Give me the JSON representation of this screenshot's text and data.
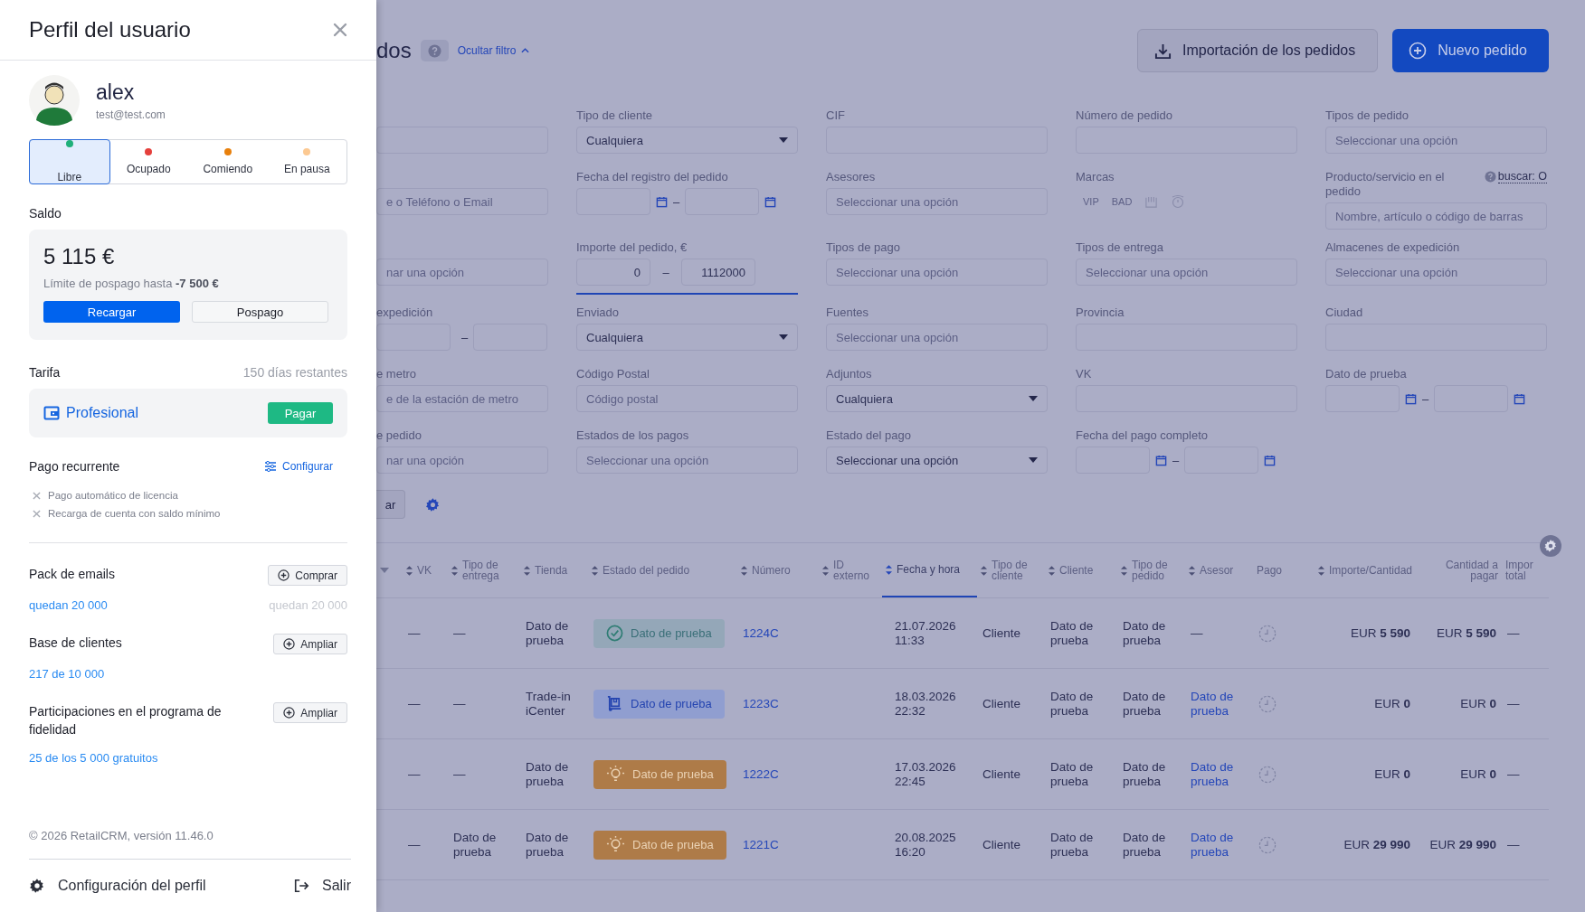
{
  "profile_panel": {
    "title": "Perfil del usuario",
    "user": {
      "name": "alex",
      "email": "test@test.com"
    },
    "statuses": [
      {
        "label": "Libre",
        "color": "#1fb07a",
        "selected": true
      },
      {
        "label": "Ocupado",
        "color": "#e5403c",
        "selected": false
      },
      {
        "label": "Comiendo",
        "color": "#e8800c",
        "selected": false
      },
      {
        "label": "En pausa",
        "color": "#fcc992",
        "selected": false
      }
    ],
    "balance": {
      "label": "Saldo",
      "amount": "5 115 €",
      "limit": "Límite de pospago hasta **-7 500 €**",
      "topup_button": "Recargar",
      "postpay_button": "Pospago"
    },
    "tariff": {
      "label": "Tarifa",
      "remaining": "150 días restantes",
      "plan": "Profesional",
      "pay_button": "Pagar"
    },
    "recurring": {
      "label": "Pago recurrente",
      "action": "Configurar",
      "items": [
        {
          "text": "Pago automático de licencia",
          "enabled": false
        },
        {
          "text": "Recarga de cuenta con saldo mínimo",
          "enabled": false
        }
      ]
    },
    "services": [
      {
        "title": "Pack de emails",
        "action": "Comprar",
        "value": "quedan 20 000",
        "note": "quedan 20 000"
      },
      {
        "title": "Base de clientes",
        "action": "Ampliar",
        "value": "217 de 10 000"
      },
      {
        "title": "Participaciones en el programa de fidelidad",
        "action": "Ampliar",
        "value": "25 de los 5 000 gratuitos"
      }
    ],
    "copyright": "© 2026 RetailCRM, versión 11.46.0",
    "footer": {
      "settings": "Configuración del perfil",
      "logout": "Salir"
    }
  },
  "page": {
    "title": "dos",
    "filter_toggle": "Ocultar filtro",
    "import_button": "Importación de los pedidos",
    "new_button": "Nuevo pedido",
    "filters": [
      {
        "kind": "text"
      },
      {
        "kind": "select",
        "label": "Tipo de cliente",
        "value": "Cualquiera"
      },
      {
        "kind": "text",
        "label": "CIF"
      },
      {
        "kind": "text",
        "label": "Número de pedido"
      },
      {
        "kind": "text",
        "label": "Tipos de pedido",
        "placeholder": "Seleccionar una opción"
      },
      {
        "kind": "text",
        "placeholder": "e o Teléfono o Email"
      },
      {
        "kind": "date_range",
        "label": "Fecha del registro del pedido",
        "separator": "–"
      },
      {
        "kind": "text",
        "label": "Asesores",
        "placeholder": "Seleccionar una opción"
      },
      {
        "kind": "tags",
        "label": "Marcas",
        "tags": [
          "VIP",
          "BAD"
        ]
      },
      {
        "kind": "text",
        "label": "Producto/servicio en el pedido",
        "hint_link": "buscar: O",
        "placeholder": "Nombre, artículo o código de barras"
      },
      {
        "kind": "text",
        "placeholder": "nar una opción"
      },
      {
        "kind": "number_range",
        "label": "Importe del pedido, €",
        "from": "0",
        "to": "1112000",
        "separator": "–",
        "focused": true
      },
      {
        "kind": "text",
        "label": "Tipos de pago",
        "placeholder": "Seleccionar una opción"
      },
      {
        "kind": "text",
        "label": "Tipos de entrega",
        "placeholder": "Seleccionar una opción"
      },
      {
        "kind": "text",
        "label": "Almacenes de expedición",
        "placeholder": "Seleccionar una opción"
      },
      {
        "kind": "date_range",
        "label": "expedición",
        "separator": "–"
      },
      {
        "kind": "select",
        "label": "Enviado",
        "value": "Cualquiera"
      },
      {
        "kind": "text",
        "label": "Fuentes",
        "placeholder": "Seleccionar una opción"
      },
      {
        "kind": "text",
        "label": "Provincia"
      },
      {
        "kind": "text",
        "label": "Ciudad"
      },
      {
        "kind": "text",
        "label": "e metro",
        "placeholder": "e de la estación de metro"
      },
      {
        "kind": "text",
        "label": "Código Postal",
        "placeholder": "Código postal"
      },
      {
        "kind": "select",
        "label": "Adjuntos",
        "value": "Cualquiera"
      },
      {
        "kind": "text",
        "label": "VK"
      },
      {
        "kind": "date_range",
        "label": "Dato de prueba",
        "separator": "–"
      },
      {
        "kind": "text",
        "label": "e pedido",
        "placeholder": "nar una opción"
      },
      {
        "kind": "text",
        "label": "Estados de los pagos",
        "placeholder": "Seleccionar una opción"
      },
      {
        "kind": "select",
        "label": "Estado del pago",
        "value": "Seleccionar una opción"
      },
      {
        "kind": "date_range",
        "label": "Fecha del pago completo",
        "separator": "–"
      }
    ],
    "apply_button": "ar",
    "table": {
      "columns": [
        {
          "label": "VK",
          "sortable": true,
          "active": false
        },
        {
          "label": "Tipo de entrega",
          "sortable": true,
          "active": false
        },
        {
          "label": "Tienda",
          "sortable": true,
          "active": false
        },
        {
          "label": "Estado del pedido",
          "sortable": true,
          "active": false
        },
        {
          "label": "Número",
          "sortable": true,
          "active": false
        },
        {
          "label": "ID externo",
          "sortable": true,
          "active": false
        },
        {
          "label": "Fecha y hora",
          "sortable": true,
          "active": true
        },
        {
          "label": "Tipo de cliente",
          "sortable": true,
          "active": false
        },
        {
          "label": "Cliente",
          "sortable": true,
          "active": false
        },
        {
          "label": "Tipo de pedido",
          "sortable": true,
          "active": false
        },
        {
          "label": "Asesor",
          "sortable": true,
          "active": false
        },
        {
          "label": "Pago",
          "sortable": false,
          "active": false
        },
        {
          "label": "Importe/Cantidad",
          "sortable": true,
          "active": false
        },
        {
          "label": "Cantidad a pagar",
          "sortable": false,
          "active": false
        },
        {
          "label": "Impor total",
          "sortable": false,
          "active": false
        }
      ],
      "rows": [
        {
          "vk": "—",
          "delivery": "—",
          "store": "Dato de prueba",
          "status": {
            "kind": "done",
            "text": "Dato de prueba"
          },
          "number": "1224C",
          "date": "21.07.2026 11:33",
          "client_type": "Cliente",
          "client": "Dato de prueba",
          "order_type": "Dato de prueba",
          "manager": {
            "text": "—",
            "link": false
          },
          "amount": "EUR **5 590**",
          "to_pay": "EUR **5 590**",
          "total": "—"
        },
        {
          "vk": "—",
          "delivery": "—",
          "store": "Trade-in iCenter",
          "status": {
            "kind": "delivery",
            "text": "Dato de prueba"
          },
          "number": "1223C",
          "date": "18.03.2026 22:32",
          "client_type": "Cliente",
          "client": "Dato de prueba",
          "order_type": "Dato de prueba",
          "manager": {
            "text": "Dato de prueba",
            "link": true
          },
          "amount": "EUR **0**",
          "to_pay": "EUR **0**",
          "total": "—"
        },
        {
          "vk": "—",
          "delivery": "—",
          "store": "Dato de prueba",
          "status": {
            "kind": "new",
            "text": "Dato de prueba"
          },
          "number": "1222C",
          "date": "17.03.2026 22:45",
          "client_type": "Cliente",
          "client": "Dato de prueba",
          "order_type": "Dato de prueba",
          "manager": {
            "text": "Dato de prueba",
            "link": true
          },
          "amount": "EUR **0**",
          "to_pay": "EUR **0**",
          "total": "—"
        },
        {
          "vk": "—",
          "delivery": "Dato de prueba",
          "store": "Dato de prueba",
          "status": {
            "kind": "new",
            "text": "Dato de prueba"
          },
          "number": "1221C",
          "date": "20.08.2025 16:20",
          "client_type": "Cliente",
          "client": "Dato de prueba",
          "order_type": "Dato de prueba",
          "manager": {
            "text": "Dato de prueba",
            "link": true
          },
          "amount": "EUR **29 990**",
          "to_pay": "EUR **29 990**",
          "total": "—"
        }
      ]
    }
  }
}
